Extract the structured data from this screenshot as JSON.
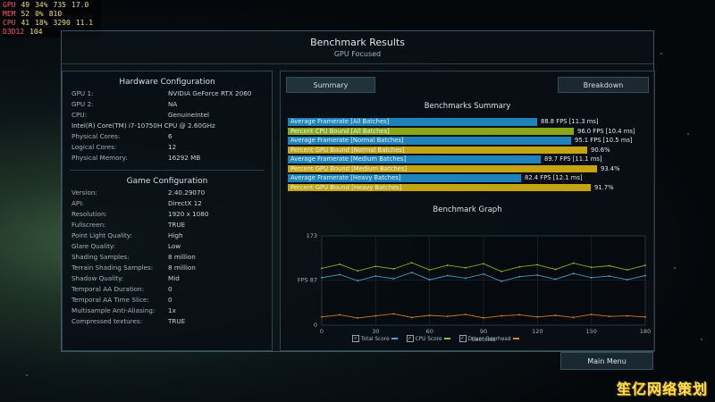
{
  "overlay": {
    "rows": [
      {
        "label": "GPU",
        "a": "49",
        "b": "34%",
        "c": "735",
        "d": "17.0"
      },
      {
        "label": "MEM",
        "a": "52",
        "b": "0%",
        "c": "810",
        "d": ""
      },
      {
        "label": "CPU",
        "a": "41",
        "b": "18%",
        "c": "3290",
        "d": "11.1"
      },
      {
        "label": "D3D12",
        "a": "104",
        "b": "",
        "c": "",
        "d": ""
      }
    ]
  },
  "window": {
    "title": "Benchmark Results",
    "subtitle": "GPU Focused"
  },
  "hardware": {
    "title": "Hardware Configuration",
    "items": [
      {
        "key": "GPU 1:",
        "value": "NVIDIA GeForce RTX 2060"
      },
      {
        "key": "GPU 2:",
        "value": "NA"
      },
      {
        "key": "CPU:",
        "value": "GenuineIntel"
      },
      {
        "key": "",
        "value": "Intel(R) Core(TM) i7-10750H CPU @ 2.60GHz"
      },
      {
        "key": "Physical Cores:",
        "value": "6"
      },
      {
        "key": "Logical Cores:",
        "value": "12"
      },
      {
        "key": "Physical Memory:",
        "value": "16292 MB"
      }
    ]
  },
  "game": {
    "title": "Game Configuration",
    "items": [
      {
        "key": "Version:",
        "value": "2.40.29070"
      },
      {
        "key": "API:",
        "value": "DirectX 12"
      },
      {
        "key": "Resolution:",
        "value": "1920 x 1080"
      },
      {
        "key": "Fullscreen:",
        "value": "TRUE"
      },
      {
        "key": "Point Light Quality:",
        "value": "High"
      },
      {
        "key": "Glare Quality:",
        "value": "Low"
      },
      {
        "key": "Shading Samples:",
        "value": "8 million"
      },
      {
        "key": "Terrain Shading Samples:",
        "value": "8 million"
      },
      {
        "key": "Shadow Quality:",
        "value": "Mid"
      },
      {
        "key": "Temporal AA Duration:",
        "value": "0"
      },
      {
        "key": "Temporal AA Time Slice:",
        "value": "0"
      },
      {
        "key": "Multisample Anti-Aliasing:",
        "value": "1x"
      },
      {
        "key": "Compressed textures:",
        "value": "TRUE"
      }
    ]
  },
  "tabs": {
    "summary": "Summary",
    "breakdown": "Breakdown"
  },
  "summary": {
    "title": "Benchmarks Summary",
    "rows": [
      {
        "label": "Average Framerate [All Batches]",
        "value": "88.8 FPS [11.3 ms]",
        "fraction": 0.755,
        "color": "#1f82b8"
      },
      {
        "label": "Percent CPU Bound [All Batches]",
        "value": "96.0 FPS [10.4 ms]",
        "fraction": 0.865,
        "color": "#8ca61a"
      },
      {
        "label": "Average Framerate [Normal Batches]",
        "value": "95.1 FPS [10.5 ms]",
        "fraction": 0.858,
        "color": "#1f82b8"
      },
      {
        "label": "Percent GPU Bound [Normal Batches]",
        "value": "90.6%",
        "fraction": 0.906,
        "color": "#c5a413"
      },
      {
        "label": "Average Framerate [Medium Batches]",
        "value": "89.7 FPS [11.1 ms]",
        "fraction": 0.765,
        "color": "#1f82b8"
      },
      {
        "label": "Percent GPU Bound [Medium Batches]",
        "value": "93.4%",
        "fraction": 0.934,
        "color": "#c5a413"
      },
      {
        "label": "Average Framerate [Heavy Batches]",
        "value": "82.4 FPS [12.1 ms]",
        "fraction": 0.705,
        "color": "#1f82b8"
      },
      {
        "label": "Percent GPU Bound [Heavy Batches]",
        "value": "91.7%",
        "fraction": 0.917,
        "color": "#c5a413"
      }
    ]
  },
  "chart_data": {
    "type": "line",
    "title": "Benchmark Graph",
    "xlabel": "Seconds",
    "ylabel": "FPS",
    "xlim": [
      0,
      180
    ],
    "ylim": [
      0,
      173
    ],
    "x_ticks": [
      0,
      30,
      60,
      90,
      120,
      150,
      180
    ],
    "y_ticks": [
      {
        "value": 173,
        "label": "173"
      },
      {
        "value": 87,
        "label": "FPS 87"
      },
      {
        "value": 0,
        "label": "0"
      }
    ],
    "series": [
      {
        "name": "Total Score",
        "color": "#4aa6d8",
        "x": [
          0,
          10,
          20,
          30,
          40,
          50,
          60,
          70,
          80,
          90,
          100,
          110,
          120,
          130,
          140,
          150,
          160,
          170,
          180
        ],
        "values": [
          92,
          98,
          86,
          95,
          90,
          102,
          88,
          96,
          91,
          99,
          85,
          94,
          97,
          89,
          100,
          92,
          95,
          88,
          96
        ]
      },
      {
        "name": "CPU Score",
        "color": "#8fc21f",
        "x": [
          0,
          10,
          20,
          30,
          40,
          50,
          60,
          70,
          80,
          90,
          100,
          110,
          120,
          130,
          140,
          150,
          160,
          170,
          180
        ],
        "values": [
          110,
          118,
          105,
          114,
          109,
          121,
          107,
          116,
          111,
          119,
          104,
          113,
          117,
          108,
          120,
          112,
          115,
          107,
          116
        ]
      },
      {
        "name": "Driver Overhead",
        "color": "#e08a1e",
        "x": [
          0,
          10,
          20,
          30,
          40,
          50,
          60,
          70,
          80,
          90,
          100,
          110,
          120,
          130,
          140,
          150,
          160,
          170,
          180
        ],
        "values": [
          16,
          20,
          14,
          18,
          22,
          15,
          19,
          17,
          21,
          14,
          18,
          20,
          16,
          19,
          15,
          21,
          17,
          18,
          16
        ]
      }
    ],
    "legend_position": "bottom"
  },
  "buttons": {
    "main_menu": "Main Menu"
  },
  "watermark": "笙亿网络策划"
}
